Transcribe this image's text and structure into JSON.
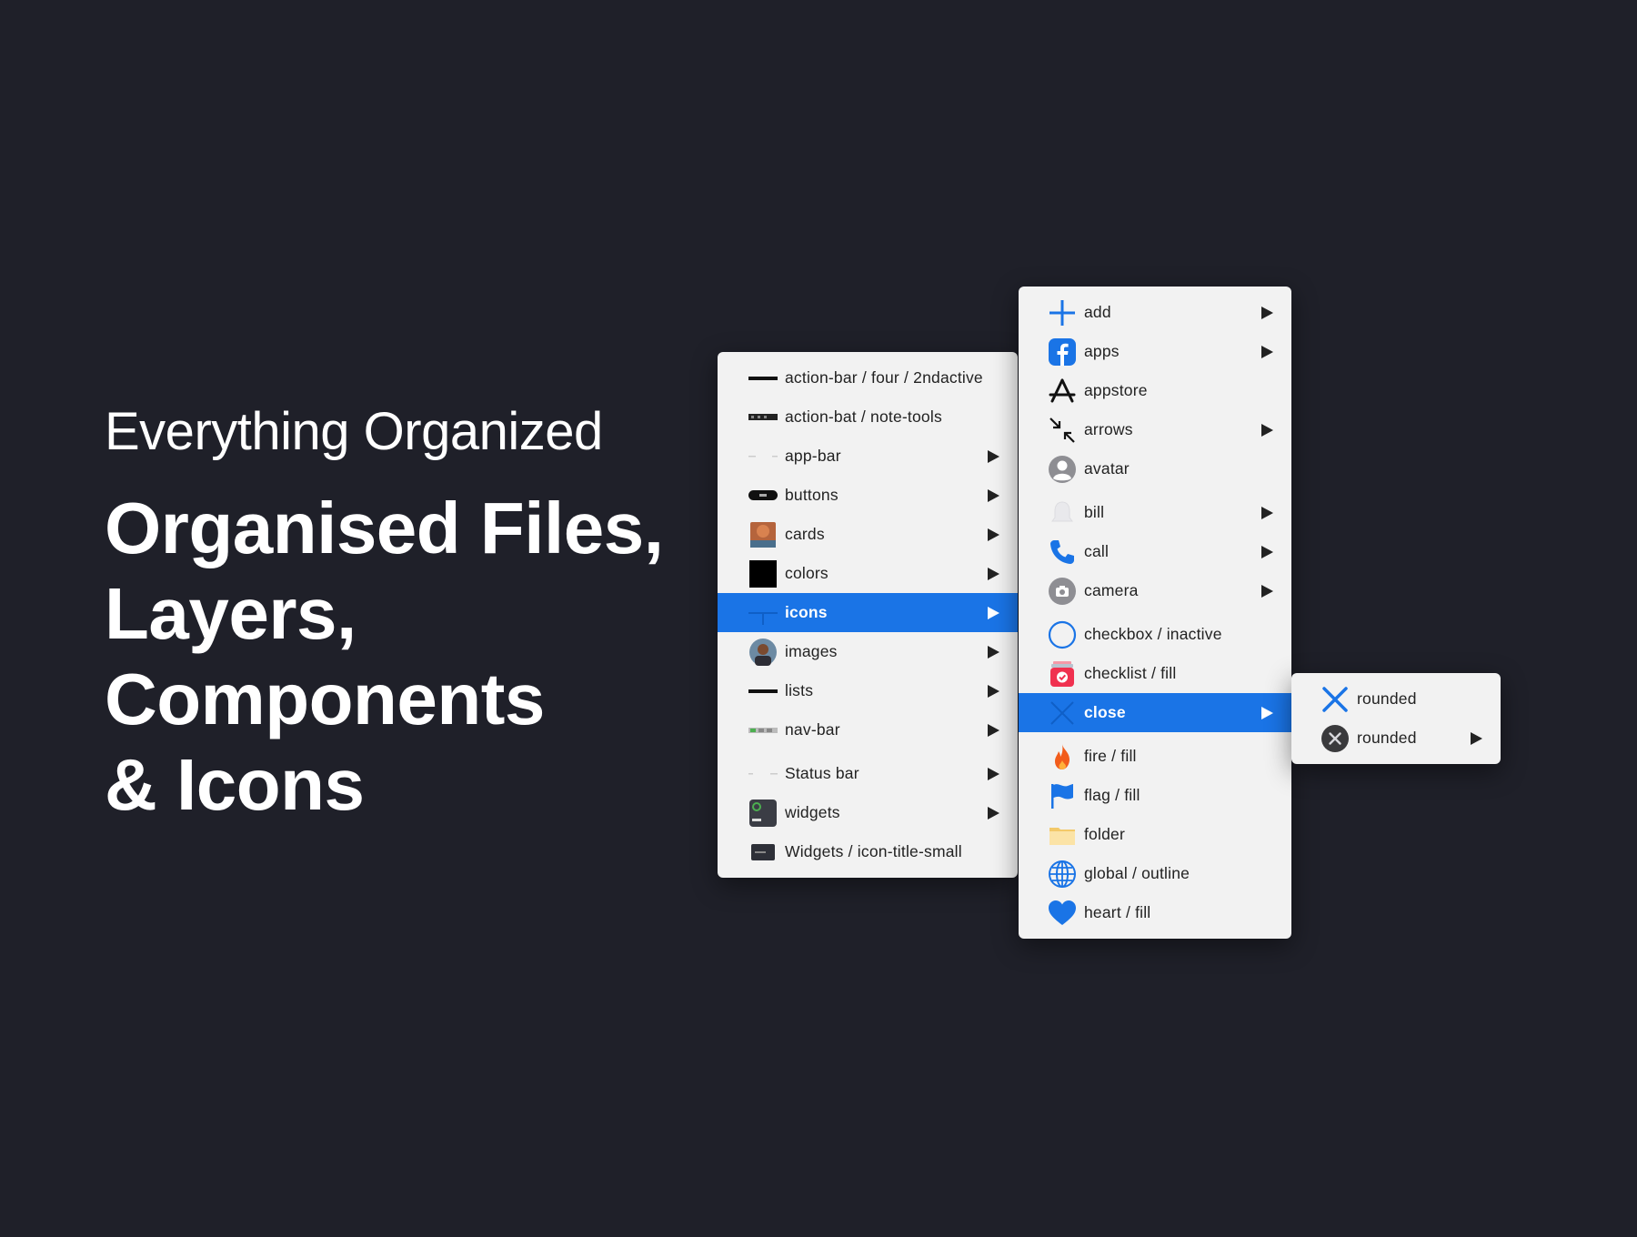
{
  "headline": {
    "subtitle": "Everything Organized",
    "title_lines": [
      "Organised Files,",
      "Layers,",
      "Components",
      "& Icons"
    ]
  },
  "menu1": {
    "items": [
      {
        "label": "action-bar / four / 2ndactive",
        "icon": "bar-thumb-icon",
        "submenu": false
      },
      {
        "label": "action-bat / note-tools",
        "icon": "toolbar-thumb-icon",
        "submenu": false
      },
      {
        "label": "app-bar",
        "icon": "app-bar-thumb-icon",
        "submenu": true
      },
      {
        "label": "buttons",
        "icon": "button-thumb-icon",
        "submenu": true
      },
      {
        "label": "cards",
        "icon": "card-thumb-icon",
        "submenu": true
      },
      {
        "label": "colors",
        "icon": "color-swatch-icon",
        "submenu": true
      },
      {
        "label": "icons",
        "icon": "icons-thumb-icon",
        "submenu": true,
        "selected": true
      },
      {
        "label": "images",
        "icon": "image-thumb-icon",
        "submenu": true
      },
      {
        "label": "lists",
        "icon": "list-thumb-icon",
        "submenu": true
      },
      {
        "label": "nav-bar",
        "icon": "nav-bar-thumb-icon",
        "submenu": true
      },
      {
        "label": "Status bar",
        "icon": "status-bar-thumb-icon",
        "submenu": true
      },
      {
        "label": "widgets",
        "icon": "widget-thumb-icon",
        "submenu": true
      },
      {
        "label": "Widgets / icon-title-small",
        "icon": "widget-small-thumb-icon",
        "submenu": false
      }
    ]
  },
  "menu2": {
    "items": [
      {
        "label": "add",
        "icon": "plus-icon",
        "submenu": true
      },
      {
        "label": "apps",
        "icon": "facebook-icon",
        "submenu": true
      },
      {
        "label": "appstore",
        "icon": "appstore-icon",
        "submenu": false
      },
      {
        "label": "arrows",
        "icon": "arrows-icon",
        "submenu": true
      },
      {
        "label": "avatar",
        "icon": "avatar-icon",
        "submenu": false
      },
      {
        "label": "bill",
        "icon": "bell-icon",
        "submenu": true
      },
      {
        "label": "call",
        "icon": "phone-icon",
        "submenu": true
      },
      {
        "label": "camera",
        "icon": "camera-icon",
        "submenu": true
      },
      {
        "label": "checkbox / inactive",
        "icon": "checkbox-icon",
        "submenu": false
      },
      {
        "label": "checklist / fill",
        "icon": "checklist-icon",
        "submenu": false
      },
      {
        "label": "close",
        "icon": "close-icon",
        "submenu": true,
        "selected": true
      },
      {
        "label": "fire / fill",
        "icon": "fire-icon",
        "submenu": false
      },
      {
        "label": "flag / fill",
        "icon": "flag-icon",
        "submenu": false
      },
      {
        "label": "folder",
        "icon": "folder-icon",
        "submenu": false
      },
      {
        "label": "global / outline",
        "icon": "globe-icon",
        "submenu": false
      },
      {
        "label": "heart / fill",
        "icon": "heart-icon",
        "submenu": false
      }
    ]
  },
  "menu3": {
    "items": [
      {
        "label": "rounded",
        "icon": "close-x-icon",
        "submenu": false
      },
      {
        "label": "rounded",
        "icon": "close-circle-icon",
        "submenu": true
      }
    ]
  },
  "colors": {
    "background": "#1f2029",
    "menu_bg": "#f2f2f2",
    "selection": "#1a74e6",
    "icon_blue": "#1a74e6"
  }
}
